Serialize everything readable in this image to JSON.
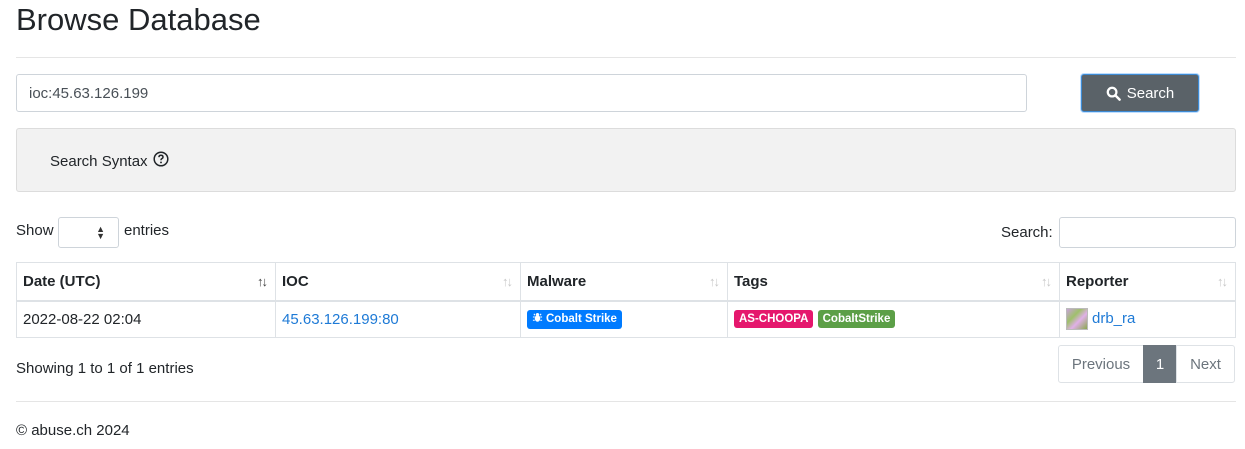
{
  "page": {
    "title": "Browse Database"
  },
  "search": {
    "query": "ioc:45.63.126.199",
    "button_label": "Search"
  },
  "syntax": {
    "label": "Search Syntax"
  },
  "table_controls": {
    "show_label": "Show",
    "entries_label": "entries",
    "filter_label": "Search:"
  },
  "table": {
    "columns": [
      "Date (UTC)",
      "IOC",
      "Malware",
      "Tags",
      "Reporter"
    ],
    "rows": [
      {
        "date": "2022-08-22 02:04",
        "ioc": "45.63.126.199:80",
        "malware": "Cobalt Strike",
        "tags": [
          "AS-CHOOPA",
          "CobaltStrike"
        ],
        "reporter": "drb_ra"
      }
    ]
  },
  "colors": {
    "malware_badge": "#007bff",
    "tag_as": "#e5176d",
    "tag_family": "#5c9f47",
    "primary_button": "#5a6268",
    "link": "#1e7ad6"
  },
  "pagination": {
    "info": "Showing 1 to 1 of 1 entries",
    "previous": "Previous",
    "current": "1",
    "next": "Next"
  },
  "footer": {
    "text": "© abuse.ch 2024"
  }
}
